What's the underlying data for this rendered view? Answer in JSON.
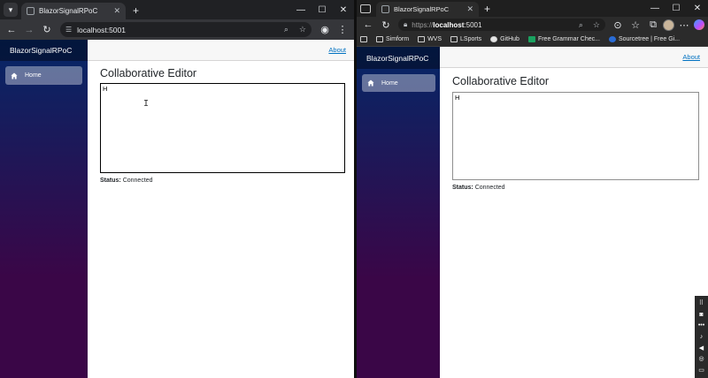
{
  "left_browser": {
    "tab_title": "BlazorSignalRPoC",
    "url": "localhost:5001",
    "app": {
      "brand": "BlazorSignalRPoC",
      "nav_home": "Home",
      "about": "About",
      "page_title": "Collaborative Editor",
      "editor_text": "H",
      "status_label": "Status:",
      "status_value": "Connected"
    }
  },
  "right_browser": {
    "tab_title": "BlazorSignalRPoC",
    "url_protocol": "https://",
    "url_host": "localhost",
    "url_port": ":5001",
    "bookmarks": [
      "Simform",
      "WVS",
      "LSports",
      "GitHub",
      "Free Grammar Chec...",
      "Sourcetree | Free Gi..."
    ],
    "app": {
      "brand": "BlazorSignalRPoC",
      "nav_home": "Home",
      "about": "About",
      "page_title": "Collaborative Editor",
      "editor_text": "H",
      "status_label": "Status:",
      "status_value": "Connected"
    }
  },
  "colors": {
    "sidebar_top": "#052767",
    "sidebar_bottom": "#3a0647",
    "link": "#0071c1"
  }
}
